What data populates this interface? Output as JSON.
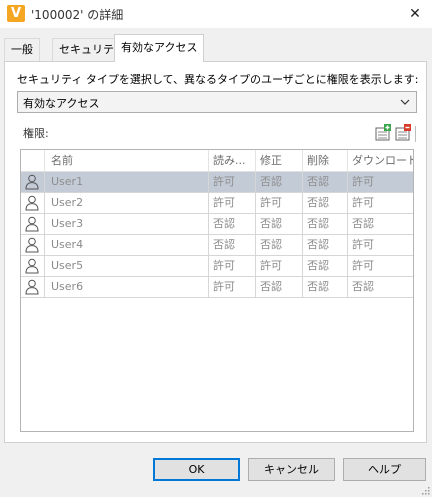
{
  "window": {
    "title": "'100002' の詳細",
    "app_icon_letter": "V",
    "accent": "#f5a623"
  },
  "tabs": [
    {
      "label": "一般",
      "active": false
    },
    {
      "label": "セキュリティ",
      "active": false
    },
    {
      "label": "有効なアクセス",
      "active": true
    }
  ],
  "instruction": "セキュリティ タイプを選択して、異なるタイプのユーザごとに権限を表示します:",
  "security_type": {
    "selected": "有効なアクセス"
  },
  "permissions_label": "権限:",
  "toolbar": {
    "add_icon": "add-permission-icon",
    "remove_icon": "remove-permission-icon"
  },
  "table": {
    "columns": [
      "",
      "名前",
      "読み...",
      "修正",
      "削除",
      "ダウンロード"
    ],
    "rows": [
      {
        "name": "User1",
        "read": "許可",
        "modify": "否認",
        "delete": "否認",
        "download": "許可",
        "selected": true
      },
      {
        "name": "User2",
        "read": "許可",
        "modify": "許可",
        "delete": "否認",
        "download": "許可",
        "selected": false
      },
      {
        "name": "User3",
        "read": "否認",
        "modify": "否認",
        "delete": "否認",
        "download": "否認",
        "selected": false
      },
      {
        "name": "User4",
        "read": "否認",
        "modify": "否認",
        "delete": "否認",
        "download": "許可",
        "selected": false
      },
      {
        "name": "User5",
        "read": "許可",
        "modify": "許可",
        "delete": "否認",
        "download": "許可",
        "selected": false
      },
      {
        "name": "User6",
        "read": "許可",
        "modify": "否認",
        "delete": "否認",
        "download": "否認",
        "selected": false
      }
    ]
  },
  "buttons": {
    "ok": "OK",
    "cancel": "キャンセル",
    "help": "ヘルプ"
  }
}
